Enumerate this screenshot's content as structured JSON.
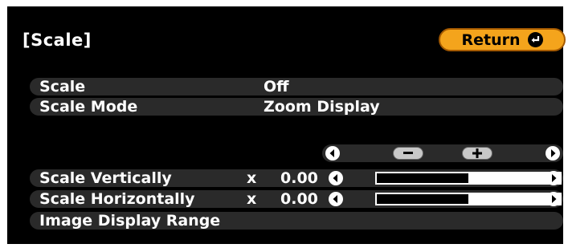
{
  "menu": {
    "title": "[Scale]",
    "return_label": "Return",
    "items": [
      {
        "label": "Scale",
        "value": "Off"
      },
      {
        "label": "Scale Mode",
        "value": "Zoom Display"
      }
    ],
    "adjust": {
      "rows": [
        {
          "label": "Scale Vertically",
          "x_mark": "x",
          "value": "0.00",
          "level": 0.5
        },
        {
          "label": "Scale Horizontally",
          "x_mark": "x",
          "value": "0.00",
          "level": 0.5
        }
      ]
    },
    "last_item": {
      "label": "Image Display Range"
    }
  },
  "icons": {
    "return": "enter-icon",
    "left": "left-arrow-icon",
    "right": "right-arrow-icon",
    "minus": "minus-icon",
    "plus": "plus-icon"
  },
  "colors": {
    "background": "#000000",
    "row": "#2a2a2a",
    "return_button": "#f4a41c",
    "text": "#ffffff"
  }
}
